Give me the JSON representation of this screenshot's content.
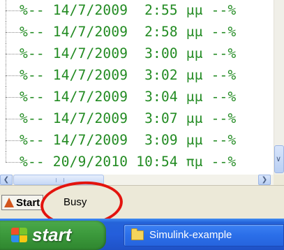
{
  "history": {
    "entries": [
      "%-- 14/7/2009  2:55 μμ --%",
      "%-- 14/7/2009  2:58 μμ --%",
      "%-- 14/7/2009  3:00 μμ --%",
      "%-- 14/7/2009  3:02 μμ --%",
      "%-- 14/7/2009  3:04 μμ --%",
      "%-- 14/7/2009  3:07 μμ --%",
      "%-- 14/7/2009  3:09 μμ --%",
      "%-- 20/9/2010 10:54 πμ --%"
    ]
  },
  "statusbar": {
    "start_label": "Start",
    "status_text": "Busy"
  },
  "taskbar": {
    "start_label": "start",
    "task_label": "Simulink-example"
  },
  "colors": {
    "history_text": "#228b22",
    "annotation_ellipse": "#e3140e",
    "taskbar_blue": "#245edb",
    "start_green": "#3c9a3c"
  },
  "icons": {
    "matlab_logo": "matlab-logo-icon",
    "windows_flag": "windows-flag-icon",
    "folder": "folder-icon"
  }
}
